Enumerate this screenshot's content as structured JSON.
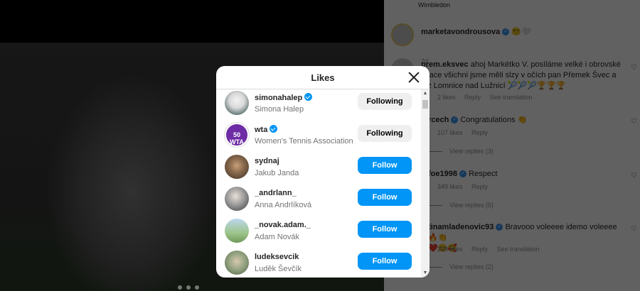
{
  "modal": {
    "title": "Likes"
  },
  "likes": [
    {
      "username": "simonahalep",
      "full_name": "Simona Halep",
      "verified": true,
      "button": "Following"
    },
    {
      "username": "wta",
      "full_name": "Women's Tennis Association",
      "verified": true,
      "button": "Following",
      "avatar_text": "50 WTA"
    },
    {
      "username": "sydnaj",
      "full_name": "Jakub Janda",
      "verified": false,
      "button": "Follow"
    },
    {
      "username": "_andrlann_",
      "full_name": "Anna Andrlíková",
      "verified": false,
      "button": "Follow"
    },
    {
      "username": "_novak.adam._",
      "full_name": "Adam Novák",
      "verified": false,
      "button": "Follow"
    },
    {
      "username": "ludeksevcik",
      "full_name": "Luděk Ševčík",
      "verified": false,
      "button": "Follow"
    }
  ],
  "comments_panel": {
    "location": "Wimbledon",
    "post_author": "marketavondrousova",
    "post_author_emoji": "😵‍💫🤍",
    "post_age": "2d",
    "comments": [
      {
        "user": "prem.eksvec",
        "text": "ahoj Markétko V. posíláme velké i obrovské",
        "text2": "tulace všichni jsme měli slzy v očích pan Přemek Švec a",
        "text3": "a z Lomnice nad Lužnicí 🎾🎾🎾🏆🏆🏆",
        "likes": "2 likes",
        "reply": "Reply",
        "translate": "See translation"
      },
      {
        "user": "rcech",
        "text": "Congratulations 👏",
        "likes": "107 likes",
        "reply": "Reply",
        "replies": "View replies (3)"
      },
      {
        "user": "foe1998",
        "text": "Respect",
        "likes": "349 likes",
        "reply": "Reply",
        "replies": "View replies (5)"
      },
      {
        "user": "tinamladenovic93",
        "text": "Bravooo voleeee idemo voleeee 🔥👏",
        "text2": "❤️😊🥰",
        "likes": "208 likes",
        "reply": "Reply",
        "translate": "See translation",
        "replies": "View replies (2)"
      }
    ]
  }
}
